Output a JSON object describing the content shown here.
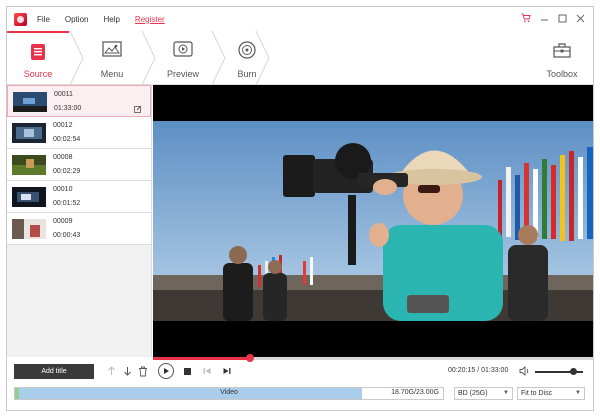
{
  "menu": {
    "file": "File",
    "option": "Option",
    "help": "Help",
    "register": "Register"
  },
  "toolbar": {
    "source": "Source",
    "menu": "Menu",
    "preview": "Preview",
    "burn": "Burn",
    "toolbox": "Toolbox"
  },
  "clips": [
    {
      "name": "00011",
      "duration": "01:33:00"
    },
    {
      "name": "00012",
      "duration": "00:02:54"
    },
    {
      "name": "00008",
      "duration": "00:02:29"
    },
    {
      "name": "00010",
      "duration": "00:01:52"
    },
    {
      "name": "00009",
      "duration": "00:00:43"
    }
  ],
  "controls": {
    "add_title": "Add title",
    "timecode": "00:20:15 / 01:33:00",
    "progress_fraction": 0.22,
    "volume_fraction": 0.8
  },
  "capacity": {
    "label": "Video",
    "amount": "18.70G/23.00G",
    "fill_fraction": 0.81,
    "disc_type": "BD (25G)",
    "fit_mode": "Fit to Disc"
  },
  "colors": {
    "accent": "#e8334a"
  }
}
